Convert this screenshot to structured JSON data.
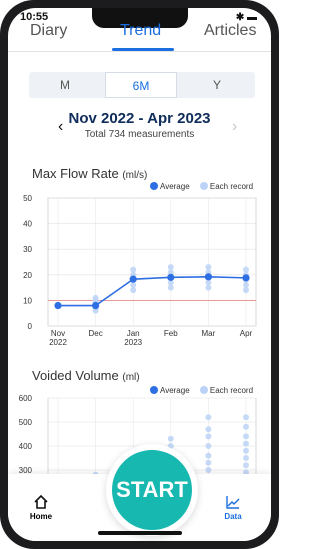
{
  "status": {
    "time": "10:55",
    "icons": "✱ ▬"
  },
  "tabs": [
    {
      "label": "Diary"
    },
    {
      "label": "Trend"
    },
    {
      "label": "Articles"
    }
  ],
  "period_selector": {
    "options": [
      "M",
      "6M",
      "Y"
    ],
    "selected": "6M"
  },
  "range": {
    "title": "Nov 2022 - Apr 2023",
    "subtitle": "Total 734 measurements"
  },
  "icons": {
    "prev": "chevron-left-icon",
    "next": "chevron-right-icon",
    "home": "home-icon",
    "data": "chart-icon"
  },
  "colors": {
    "accent": "#1b6fe0",
    "line": "#2f6fe4",
    "record": "#bcd3f7",
    "threshold": "#e88b8b",
    "start": "#17b8b0"
  },
  "chart_data": [
    {
      "type": "line",
      "title": "Max Flow Rate",
      "unit": "(ml/s)",
      "legend": [
        "Average",
        "Each record"
      ],
      "categories": [
        "Nov\n2022",
        "Dec",
        "Jan\n2023",
        "Feb",
        "Mar",
        "Apr"
      ],
      "yticks": [
        0,
        10,
        20,
        30,
        40,
        50
      ],
      "ylim": [
        0,
        50
      ],
      "reference_line": 10,
      "series": [
        {
          "name": "Average",
          "values": [
            8,
            8,
            18.3,
            19,
            19.2,
            18.8
          ]
        },
        {
          "name": "Each record",
          "points": [
            [
              1,
              6
            ],
            [
              1,
              7
            ],
            [
              1,
              8
            ],
            [
              1,
              9
            ],
            [
              1,
              10
            ],
            [
              1,
              11
            ],
            [
              2,
              14
            ],
            [
              2,
              16
            ],
            [
              2,
              18
            ],
            [
              2,
              20
            ],
            [
              2,
              22
            ],
            [
              3,
              15
            ],
            [
              3,
              17
            ],
            [
              3,
              19
            ],
            [
              3,
              21
            ],
            [
              3,
              23
            ],
            [
              4,
              15
            ],
            [
              4,
              17
            ],
            [
              4,
              19
            ],
            [
              4,
              21
            ],
            [
              4,
              23
            ],
            [
              5,
              14
            ],
            [
              5,
              16
            ],
            [
              5,
              18
            ],
            [
              5,
              20
            ],
            [
              5,
              22
            ]
          ]
        }
      ]
    },
    {
      "type": "scatter",
      "title": "Voided Volume",
      "unit": "(ml)",
      "legend": [
        "Average",
        "Each record"
      ],
      "yticks": [
        300,
        400,
        500,
        600
      ],
      "ylim": [
        250,
        600
      ],
      "series": [
        {
          "name": "Each record",
          "points": [
            [
              0,
              270
            ],
            [
              1,
              280
            ],
            [
              3,
              320
            ],
            [
              3,
              360
            ],
            [
              3,
              400
            ],
            [
              3,
              430
            ],
            [
              4,
              300
            ],
            [
              4,
              330
            ],
            [
              4,
              360
            ],
            [
              4,
              400
            ],
            [
              4,
              440
            ],
            [
              4,
              470
            ],
            [
              4,
              520
            ],
            [
              5,
              290
            ],
            [
              5,
              320
            ],
            [
              5,
              350
            ],
            [
              5,
              380
            ],
            [
              5,
              410
            ],
            [
              5,
              440
            ],
            [
              5,
              480
            ],
            [
              5,
              520
            ]
          ]
        }
      ]
    }
  ],
  "sections": {
    "flow_title": "Max Flow Rate",
    "flow_unit": "(ml/s)",
    "volume_title": "Voided Volume",
    "volume_unit": "(ml)",
    "legend_average": "Average",
    "legend_each": "Each record"
  },
  "bottom_nav": {
    "home": "Home",
    "data": "Data",
    "start": "START"
  }
}
